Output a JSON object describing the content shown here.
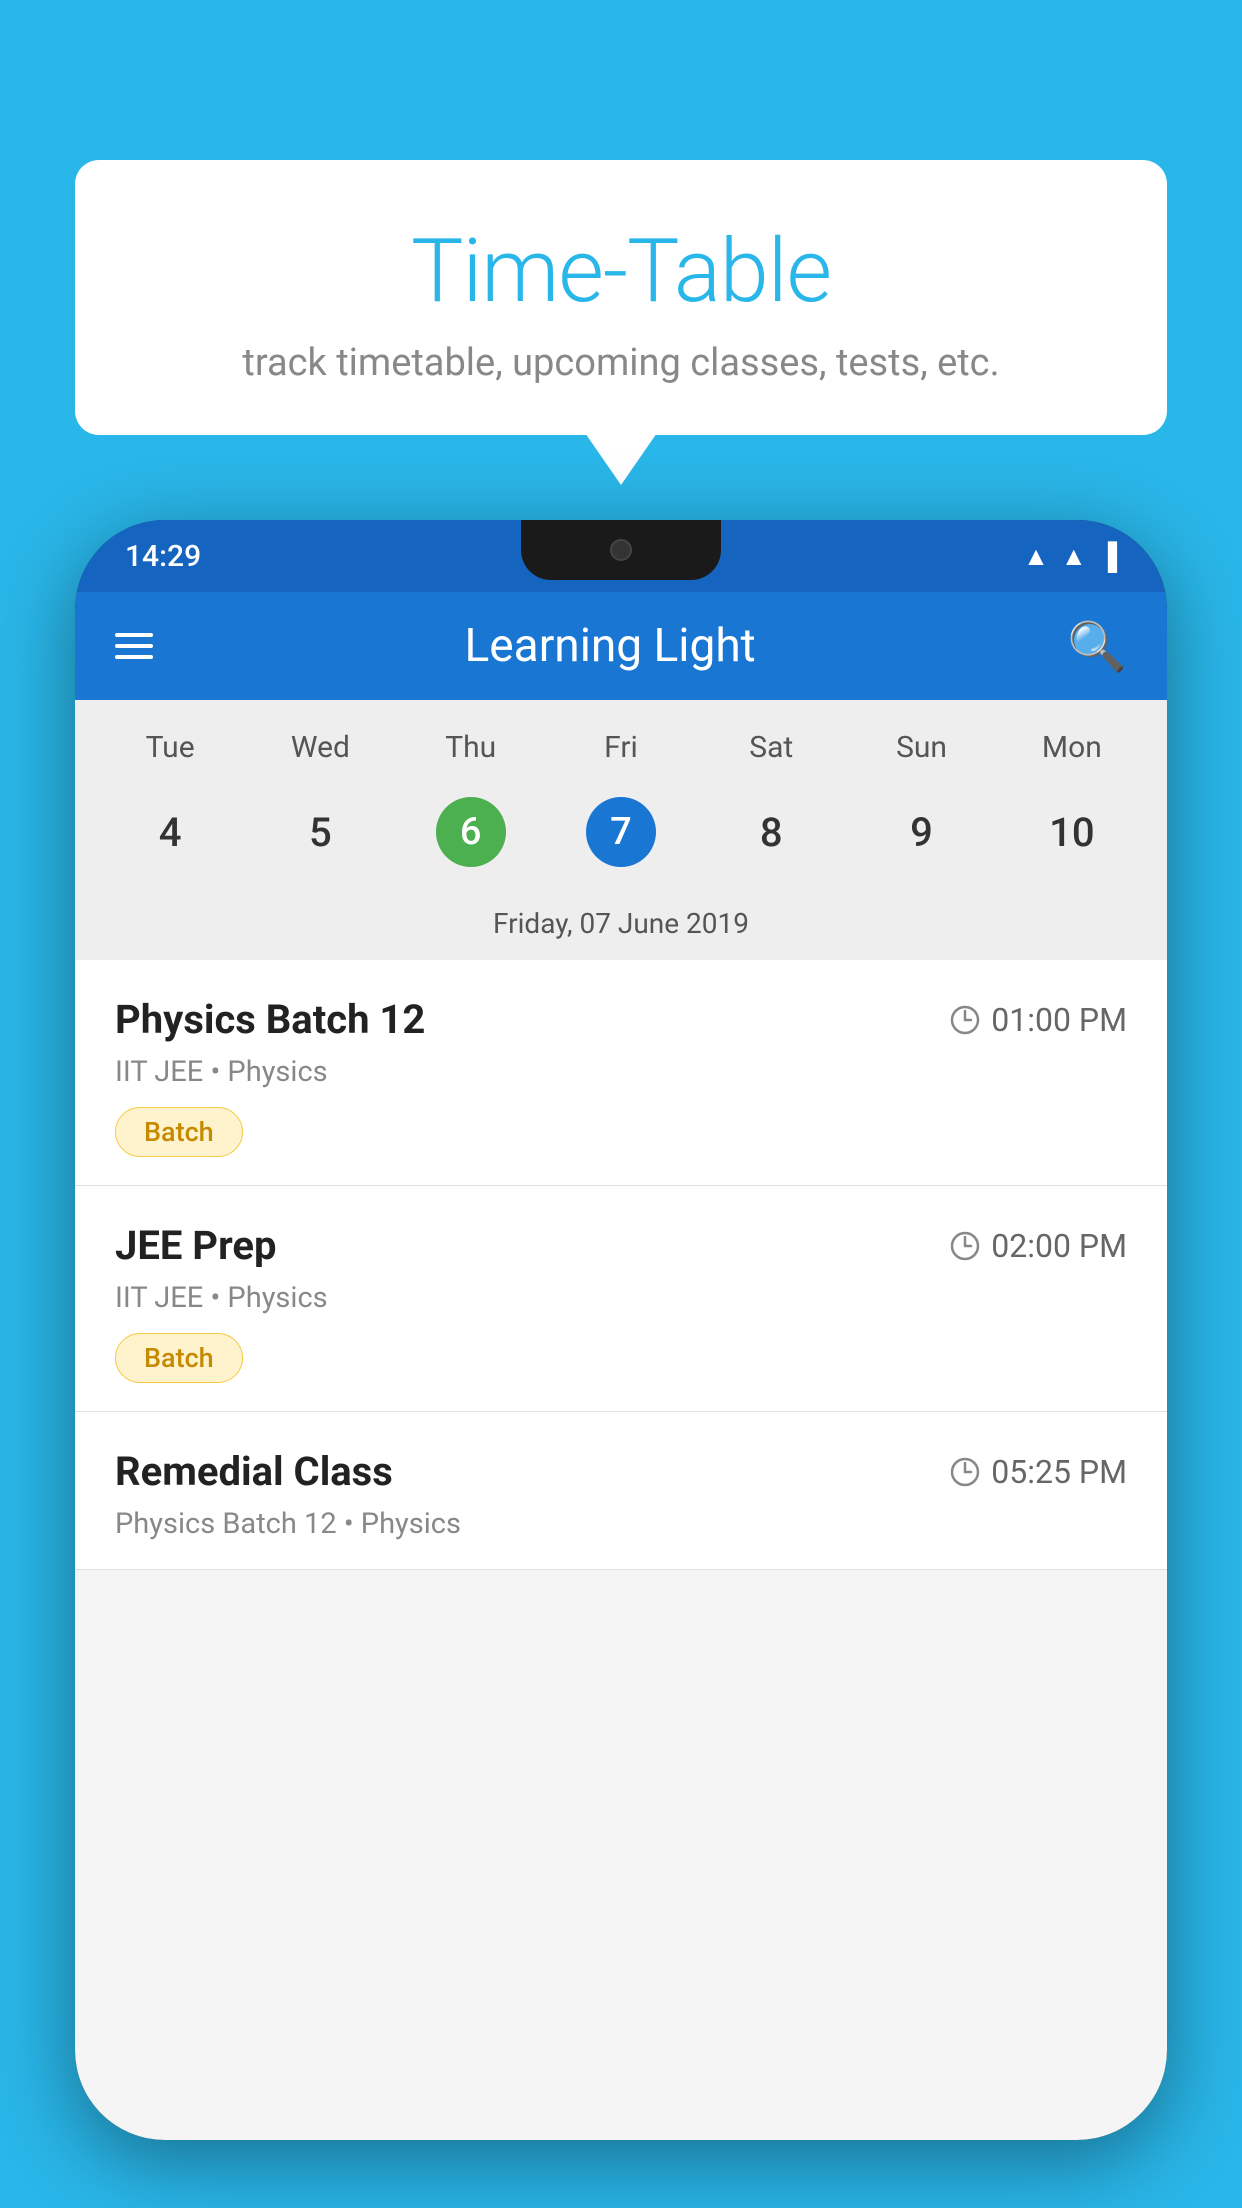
{
  "background_color": "#29B6E8",
  "speech_bubble": {
    "title": "Time-Table",
    "subtitle": "track timetable, upcoming classes, tests, etc."
  },
  "status_bar": {
    "time": "14:29",
    "wifi": "▲",
    "signal": "▲",
    "battery": "▐"
  },
  "app_bar": {
    "title": "Learning Light",
    "menu_label": "menu",
    "search_label": "search"
  },
  "calendar": {
    "days": [
      {
        "label": "Tue",
        "number": "4"
      },
      {
        "label": "Wed",
        "number": "5"
      },
      {
        "label": "Thu",
        "number": "6",
        "state": "today"
      },
      {
        "label": "Fri",
        "number": "7",
        "state": "selected"
      },
      {
        "label": "Sat",
        "number": "8"
      },
      {
        "label": "Sun",
        "number": "9"
      },
      {
        "label": "Mon",
        "number": "10"
      }
    ],
    "selected_date_label": "Friday, 07 June 2019"
  },
  "schedule": [
    {
      "title": "Physics Batch 12",
      "time": "01:00 PM",
      "subtitle": "IIT JEE • Physics",
      "tag": "Batch"
    },
    {
      "title": "JEE Prep",
      "time": "02:00 PM",
      "subtitle": "IIT JEE • Physics",
      "tag": "Batch"
    },
    {
      "title": "Remedial Class",
      "time": "05:25 PM",
      "subtitle": "Physics Batch 12 • Physics",
      "tag": ""
    }
  ]
}
